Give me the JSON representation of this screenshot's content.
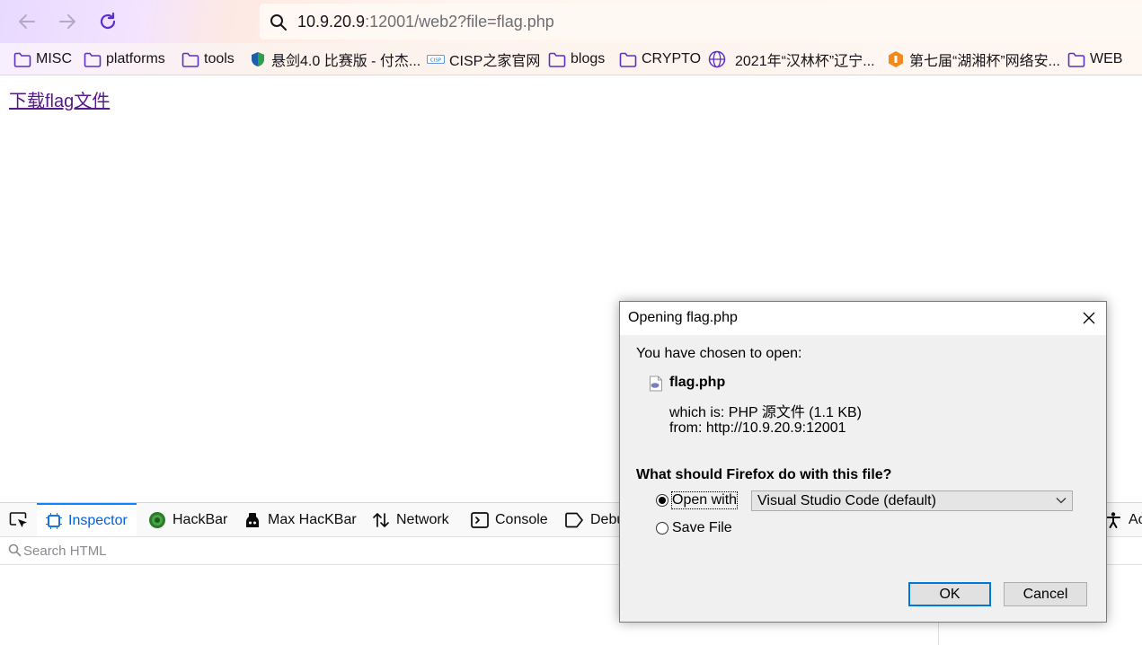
{
  "browser": {
    "url_host": "10.9.20.9",
    "url_rest": ":12001/web2?file=flag.php"
  },
  "bookmarks": [
    {
      "label": "MISC",
      "icon": "folder-icon"
    },
    {
      "label": "platforms",
      "icon": "folder-icon"
    },
    {
      "label": "tools",
      "icon": "folder-icon"
    },
    {
      "label": "悬剑4.0 比赛版 - 付杰...",
      "icon": "shield-logo-icon"
    },
    {
      "label": "CISP之家官网",
      "icon": "cisp-logo-icon"
    },
    {
      "label": "blogs",
      "icon": "folder-icon"
    },
    {
      "label": "CRYPTO",
      "icon": "folder-icon"
    },
    {
      "label": "2021年“汉林杯”辽宁...",
      "icon": "globe-icon"
    },
    {
      "label": "第七届“湖湘杯”网络安...",
      "icon": "orange-logo-icon"
    },
    {
      "label": "WEB",
      "icon": "folder-icon"
    }
  ],
  "page": {
    "download_link": "下载flag文件"
  },
  "devtools": {
    "tabs": [
      {
        "label": "Inspector",
        "icon": "inspector-icon"
      },
      {
        "label": "HackBar",
        "icon": "hackbar-icon"
      },
      {
        "label": "Max HacKBar",
        "icon": "max-hackbar-icon"
      },
      {
        "label": "Network",
        "icon": "network-icon"
      },
      {
        "label": "Console",
        "icon": "console-icon"
      },
      {
        "label": "Debu",
        "icon": "debugger-icon"
      },
      {
        "label": "Ac",
        "icon": "accessibility-icon"
      }
    ],
    "search_placeholder": "Search HTML"
  },
  "dialog": {
    "title": "Opening flag.php",
    "chosen_label": "You have chosen to open:",
    "file_name": "flag.php",
    "which_is": "which is: PHP 源文件 (1.1 KB)",
    "from": "from: http://10.9.20.9:12001",
    "question": "What should Firefox do with this file?",
    "open_with_label": "Open with",
    "open_with_app": "Visual Studio Code (default)",
    "save_file_label": "Save File",
    "selected_option": "open_with",
    "ok_label": "OK",
    "cancel_label": "Cancel"
  },
  "colors": {
    "accent": "#0060df",
    "visited_link": "#551a8b",
    "folder": "#5b2fc9"
  }
}
